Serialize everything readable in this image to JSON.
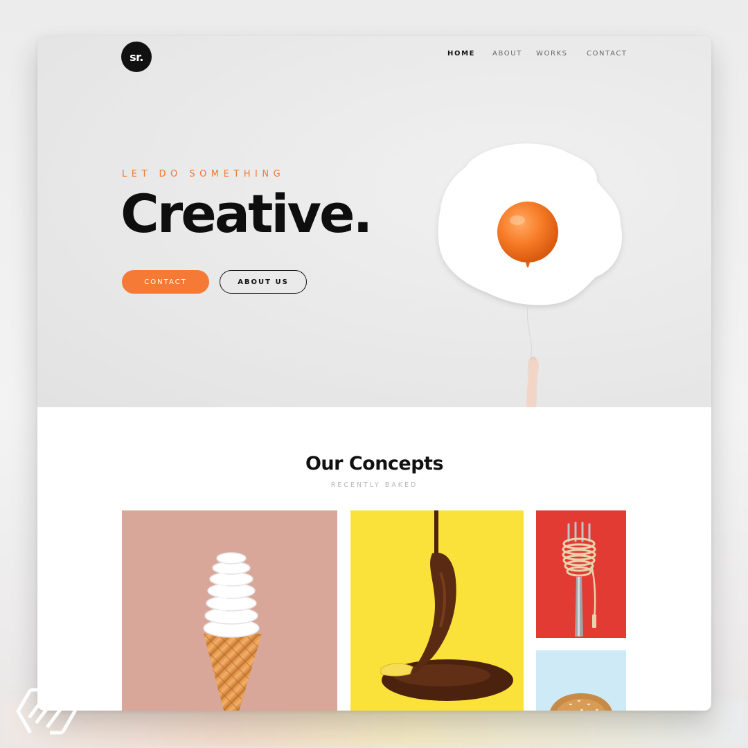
{
  "header": {
    "logo_text": "sr.",
    "nav": [
      {
        "label": "HOME",
        "active": true
      },
      {
        "label": "ABOUT",
        "active": false
      },
      {
        "label": "WORKS",
        "active": false
      },
      {
        "label": "CONTACT",
        "active": false
      }
    ]
  },
  "hero": {
    "eyebrow": "LET DO SOMETHING",
    "headline": "Creative.",
    "primary_button": "CONTACT",
    "secondary_button": "ABOUT US"
  },
  "concepts": {
    "title": "Our Concepts",
    "subtitle": "RECENTLY BAKED"
  },
  "colors": {
    "accent": "#f47a35",
    "text": "#0e0e0e",
    "tile_icecream": "#d8a799",
    "tile_banana": "#fbe23b",
    "tile_fork": "#e23b33",
    "tile_burger": "#cfeaf7"
  },
  "icons": [
    "egg-balloon-illustration",
    "lightbulb-icecream-illustration",
    "chocolate-banana-illustration",
    "spaghetti-fork-illustration",
    "burger-illustration",
    "brand-mark-logo"
  ]
}
